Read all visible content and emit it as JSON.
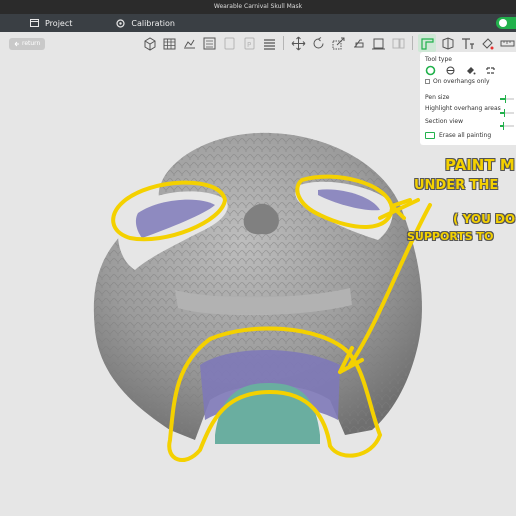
{
  "window": {
    "title": "Wearable Carnival Skull Mask"
  },
  "nav": {
    "tabs": [
      {
        "label": "Project",
        "icon": "folder-icon"
      },
      {
        "label": "Calibration",
        "icon": "calibration-icon"
      }
    ]
  },
  "viewport": {
    "return_label": "return"
  },
  "toolbar": {
    "icons": [
      "add-cube-icon",
      "grid-icon",
      "arrange-icon",
      "orient-icon",
      "plate-icon",
      "plate-alt-icon",
      "layers-icon",
      "move-icon",
      "rotate-icon",
      "scale-icon",
      "cut-icon",
      "lay-on-face-icon",
      "split-icon",
      "support-paint-icon",
      "seam-paint-icon",
      "text-icon",
      "color-paint-icon",
      "measure-icon"
    ],
    "active_icon": "support-paint-icon"
  },
  "panel": {
    "tool_type_label": "Tool type",
    "tools": [
      "circle-tool-icon",
      "sphere-tool-icon",
      "fill-tool-icon",
      "gap-fill-tool-icon"
    ],
    "on_overhangs_only_label": "On overhangs only",
    "on_overhangs_only_checked": false,
    "pen_size_label": "Pen size",
    "highlight_label": "Highlight overhang areas",
    "section_view_label": "Section view",
    "erase_label": "Erase all painting",
    "accent_color": "#22b14c"
  },
  "annotations": {
    "line1": "PAINT M",
    "line2": "UNDER THE",
    "line3": "( YOU DO",
    "line4": "SUPPORTS TO"
  },
  "colors": {
    "annotation_yellow": "#f4d100",
    "paint_purple": "#7e79b8",
    "bed_teal": "#6aaea0",
    "model_grey": "#9a9a9a"
  }
}
